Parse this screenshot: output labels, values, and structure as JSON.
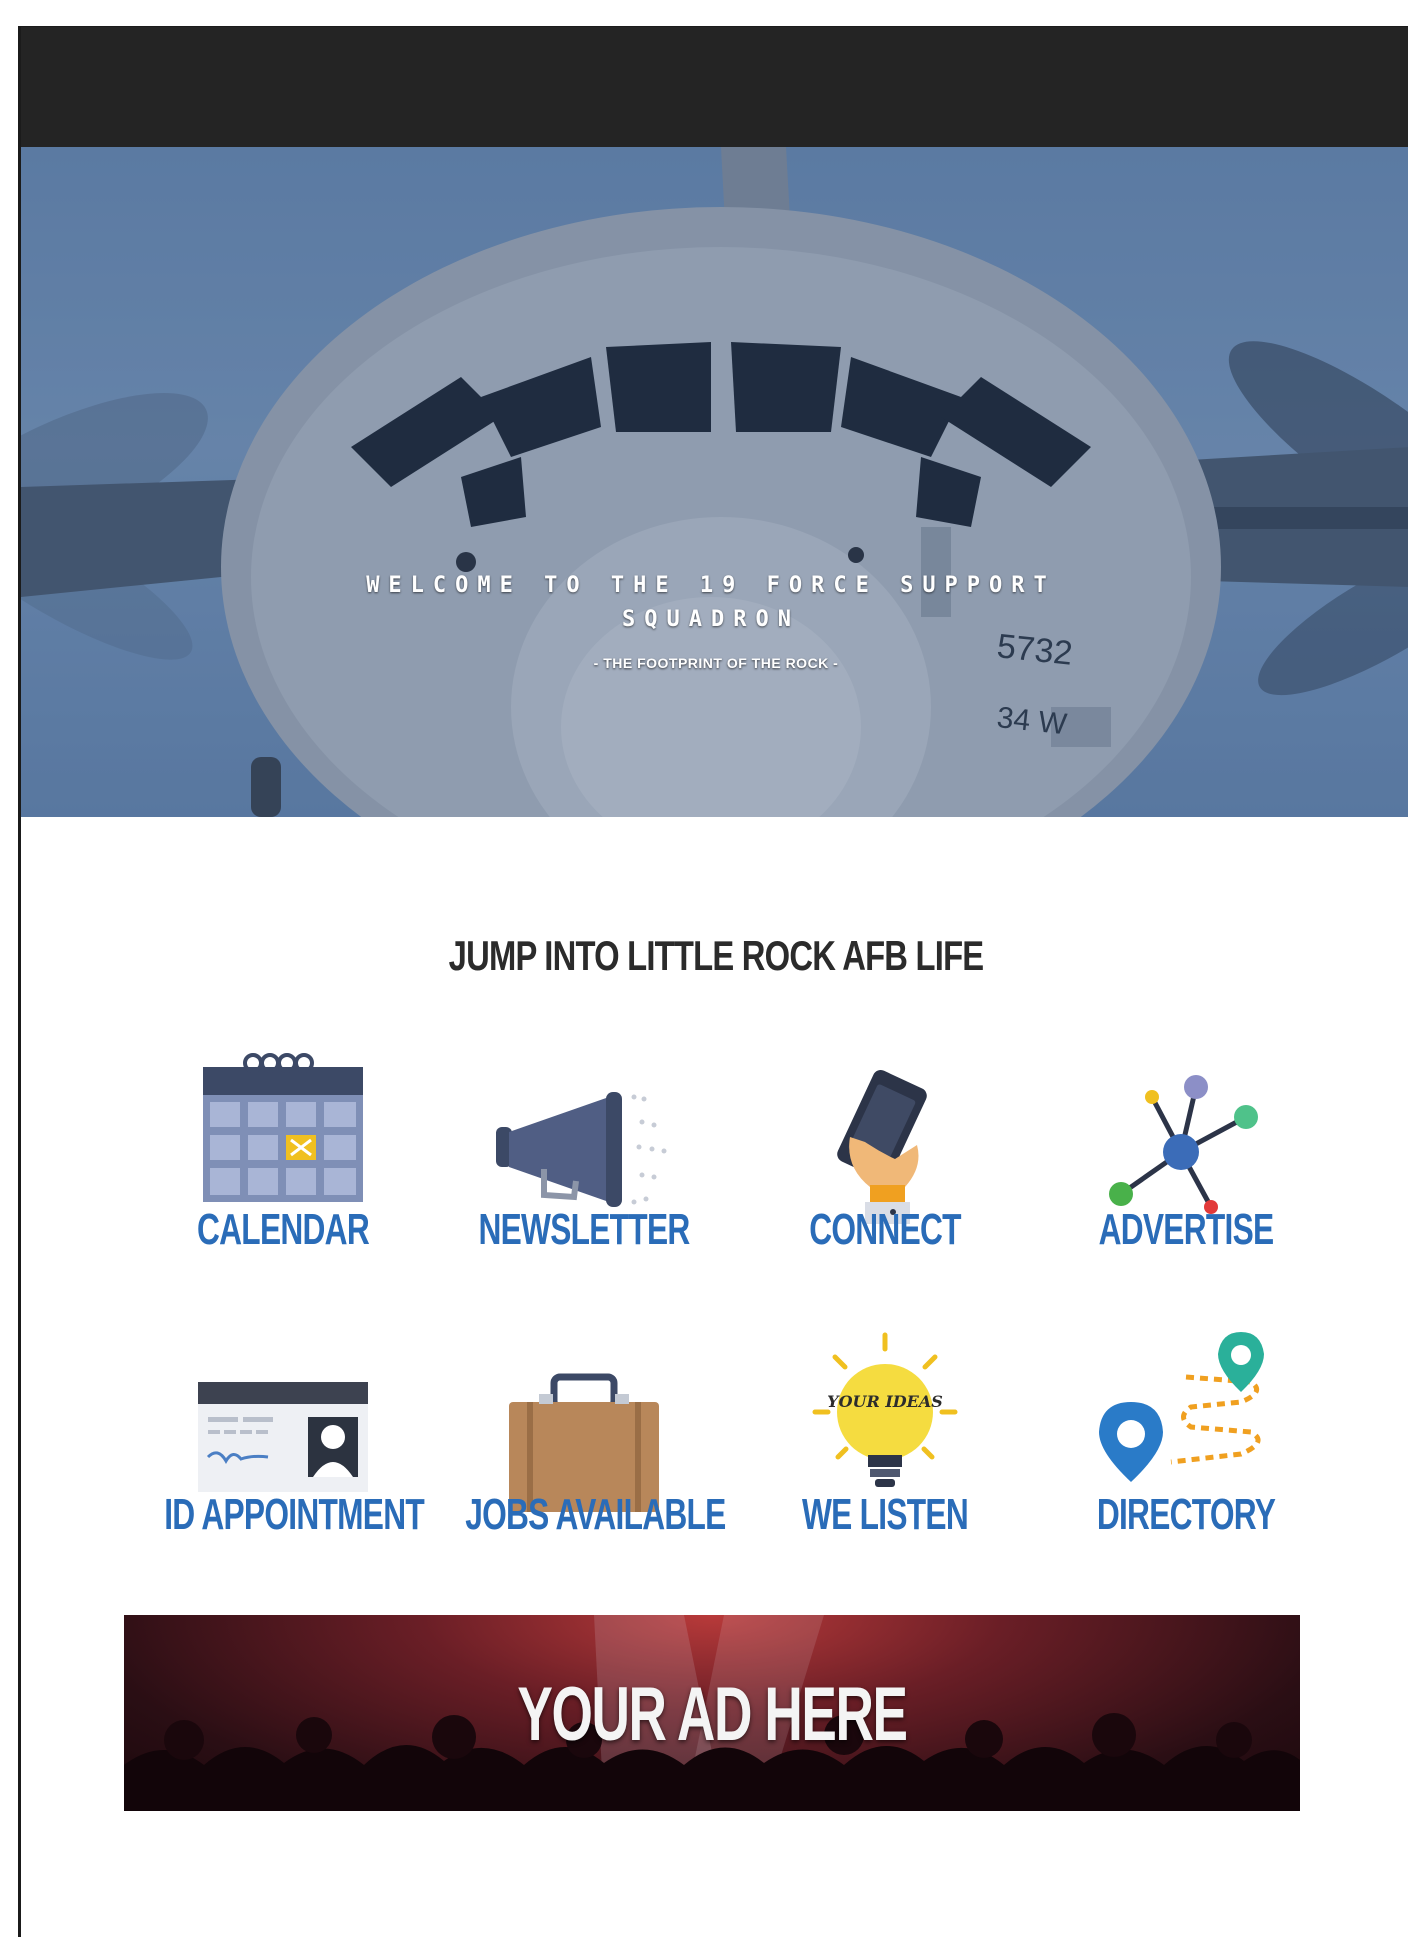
{
  "hero": {
    "title": "WELCOME TO THE 19 FORCE SUPPORT SQUADRON",
    "subtitle": "- THE FOOTPRINT OF THE ROCK -",
    "aircraft_tail_number": "5732",
    "aircraft_side_marking": "34 W"
  },
  "section": {
    "title": "JUMP INTO LITTLE ROCK AFB LIFE"
  },
  "tiles": [
    {
      "label": "CALENDAR",
      "icon": "calendar-icon"
    },
    {
      "label": "NEWSLETTER",
      "icon": "megaphone-icon"
    },
    {
      "label": "CONNECT",
      "icon": "phone-in-hand-icon"
    },
    {
      "label": "ADVERTISE",
      "icon": "network-icon"
    },
    {
      "label": "ID APPOINTMENT",
      "icon": "id-card-icon"
    },
    {
      "label": "JOBS AVAILABLE",
      "icon": "briefcase-icon"
    },
    {
      "label": "WE LISTEN",
      "icon": "lightbulb-icon",
      "icon_text": "YOUR IDEAS"
    },
    {
      "label": "DIRECTORY",
      "icon": "map-pins-icon"
    }
  ],
  "ad": {
    "label": "YOUR AD HERE"
  },
  "colors": {
    "topbar": "#242424",
    "label_blue": "#2a6cb8",
    "heading": "#2b2b2b"
  }
}
